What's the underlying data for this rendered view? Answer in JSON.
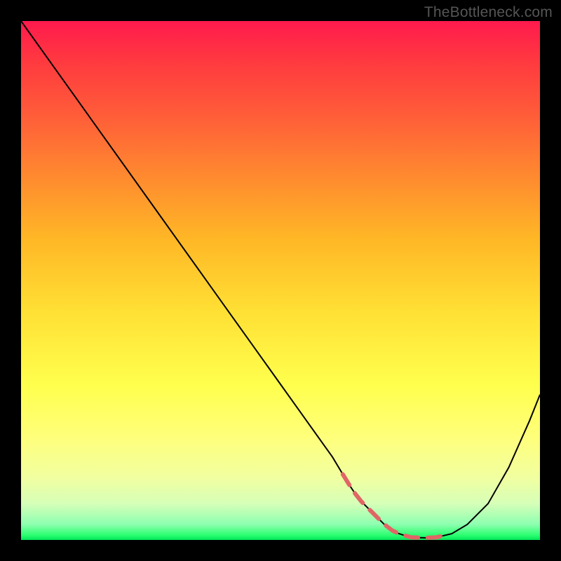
{
  "watermark": "TheBottleneck.com",
  "colors": {
    "background": "#000000",
    "gradient_top": "#ff1a4d",
    "gradient_bottom": "#00e657",
    "curve": "#000000",
    "dash": "#e06666"
  },
  "chart_data": {
    "type": "line",
    "title": "",
    "xlabel": "",
    "ylabel": "",
    "xlim": [
      0,
      100
    ],
    "ylim": [
      0,
      100
    ],
    "grid": false,
    "series": [
      {
        "name": "bottleneck-curve",
        "x": [
          0,
          5,
          10,
          15,
          20,
          25,
          30,
          35,
          40,
          45,
          50,
          55,
          60,
          63,
          65,
          68,
          70,
          72,
          75,
          78,
          80,
          83,
          86,
          90,
          94,
          98,
          100
        ],
        "y": [
          100,
          93,
          86,
          79,
          72,
          65,
          58,
          51,
          44,
          37,
          30,
          23,
          16,
          11,
          8,
          5,
          3,
          1.5,
          0.5,
          0.4,
          0.5,
          1.2,
          3,
          7,
          14,
          23,
          28
        ]
      }
    ],
    "annotations": [
      {
        "name": "optimal-range-dashes",
        "x_start": 62,
        "x_end": 83,
        "style": "dashed",
        "color": "#e06666"
      }
    ]
  }
}
